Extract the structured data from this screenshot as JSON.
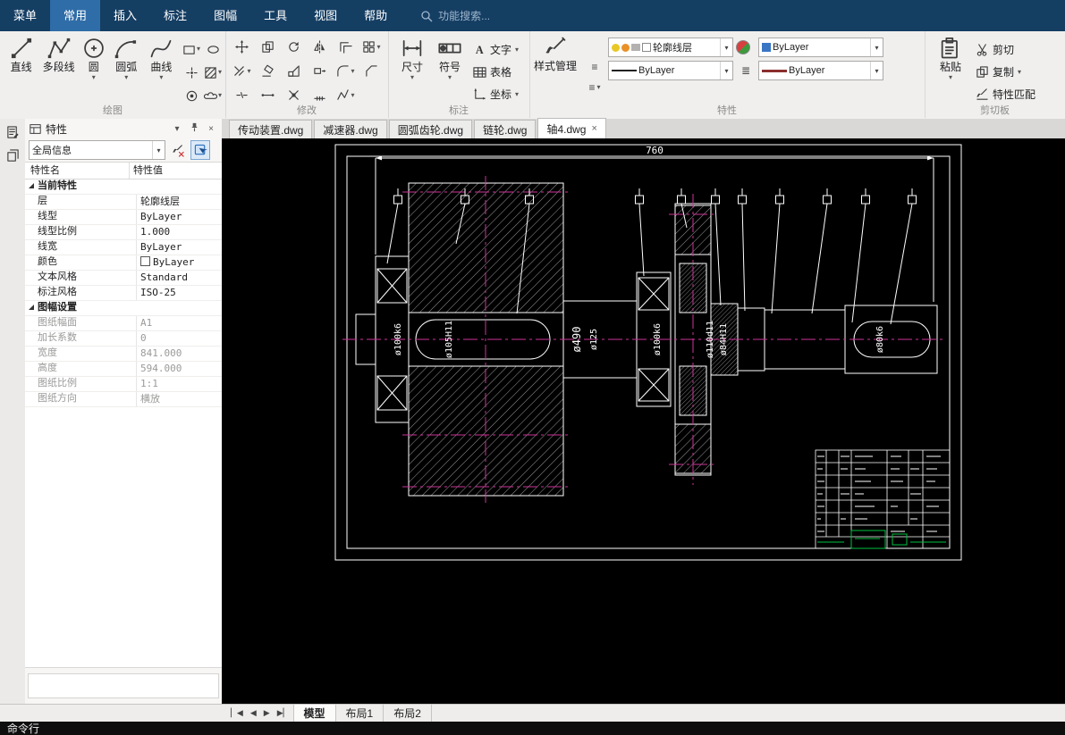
{
  "colors": {
    "menubar_bg": "#153e63",
    "menubar_active_bg": "#2f6da8",
    "canvas_bg": "#000000",
    "centerline_magenta": "#cc3399",
    "titleblock_green": "#00c040",
    "drawing_stroke": "#ffffff"
  },
  "icons": {
    "caret_down": "▾",
    "close": "×",
    "list": "≡",
    "lines": "≣",
    "text_a": "A",
    "nav_first": "▏◀",
    "nav_prev": "◀",
    "nav_next": "▶",
    "nav_last": "▶▏"
  },
  "menubar": {
    "items": [
      "菜单",
      "常用",
      "插入",
      "标注",
      "图幅",
      "工具",
      "视图",
      "帮助"
    ],
    "search": "功能搜索..."
  },
  "ribbon": {
    "draw": {
      "label": "绘图",
      "line": "直线",
      "polyline": "多段线",
      "circle": "圆",
      "arc": "圆弧",
      "spline": "曲线"
    },
    "modify": {
      "label": "修改"
    },
    "annotate": {
      "label": "标注",
      "dim": "尺寸",
      "symbol": "符号",
      "text": "文字",
      "table": "表格",
      "coord": "坐标"
    },
    "props": {
      "label": "特性",
      "style_manager": "样式管理",
      "layer": "轮廓线层",
      "color": "ByLayer",
      "linetype": "ByLayer",
      "lineweight": "ByLayer"
    },
    "clipboard": {
      "label": "剪切板",
      "paste": "粘贴",
      "cut": "剪切",
      "copy": "复制",
      "match": "特性匹配"
    }
  },
  "panel": {
    "title": "特性",
    "scope": "全局信息",
    "col_name": "特性名",
    "col_value": "特性值",
    "rows": [
      {
        "name": "当前特性",
        "value": ""
      },
      {
        "name": "层",
        "value": "轮廓线层"
      },
      {
        "name": "线型",
        "value": "ByLayer"
      },
      {
        "name": "线型比例",
        "value": "1.000"
      },
      {
        "name": "线宽",
        "value": "ByLayer"
      },
      {
        "name": "颜色",
        "value": "ByLayer"
      },
      {
        "name": "文本风格",
        "value": "Standard"
      },
      {
        "name": "标注风格",
        "value": "ISO-25"
      },
      {
        "name": "图幅设置",
        "value": ""
      },
      {
        "name": "图纸幅面",
        "value": "A1"
      },
      {
        "name": "加长系数",
        "value": "0"
      },
      {
        "name": "宽度",
        "value": "841.000"
      },
      {
        "name": "高度",
        "value": "594.000"
      },
      {
        "name": "图纸比例",
        "value": "1:1"
      },
      {
        "name": "图纸方向",
        "value": "横放"
      }
    ]
  },
  "tabs": {
    "docs": [
      "传动装置.dwg",
      "减速器.dwg",
      "圆弧齿轮.dwg",
      "链轮.dwg",
      "轴4.dwg"
    ]
  },
  "drawing": {
    "overall_length": "760",
    "dims": [
      "ø100k6",
      "ø105H11",
      "ø490",
      "ø125",
      "ø100k6",
      "ø110d11",
      "ø84H11",
      "ø80k6"
    ]
  },
  "layouts": {
    "model": "模型",
    "layout1": "布局1",
    "layout2": "布局2"
  },
  "statusbar": {
    "command_line": "命令行"
  }
}
